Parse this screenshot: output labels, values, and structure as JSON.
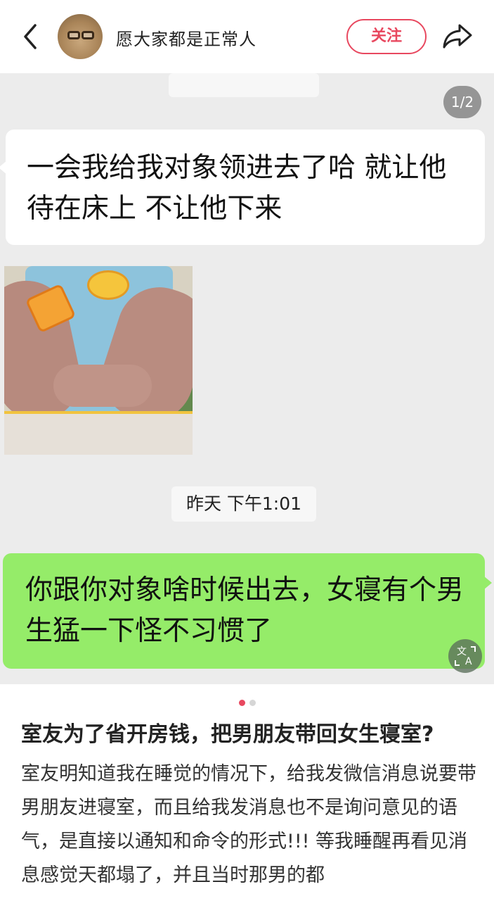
{
  "header": {
    "username": "愿大家都是正常人",
    "follow_label": "关注",
    "icons": {
      "back": "back-icon",
      "share": "share-icon"
    }
  },
  "image_viewer": {
    "page_counter": "1/2"
  },
  "chat": {
    "left_message": "一会我给我对象领进去了哈 就让他待在床上 不让他下来",
    "timestamp": "昨天 下午1:01",
    "right_message": "你跟你对象啥时候出去，女寝有个男生猛一下怪不习惯了",
    "colors": {
      "right_bubble": "#95ec69",
      "left_bubble": "#ffffff",
      "background": "#ececec"
    }
  },
  "carousel": {
    "total": 2,
    "active": 1
  },
  "post": {
    "title": "室友为了省开房钱，把男朋友带回女生寝室?",
    "body": "室友明知道我在睡觉的情况下，给我发微信消息说要带男朋友进寝室，而且给我发消息也不是询问意见的语气，是直接以通知和命令的形式!!! 等我睡醒再看见消息感觉天都塌了，并且当时那男的都"
  },
  "accent_color": "#e8485f"
}
